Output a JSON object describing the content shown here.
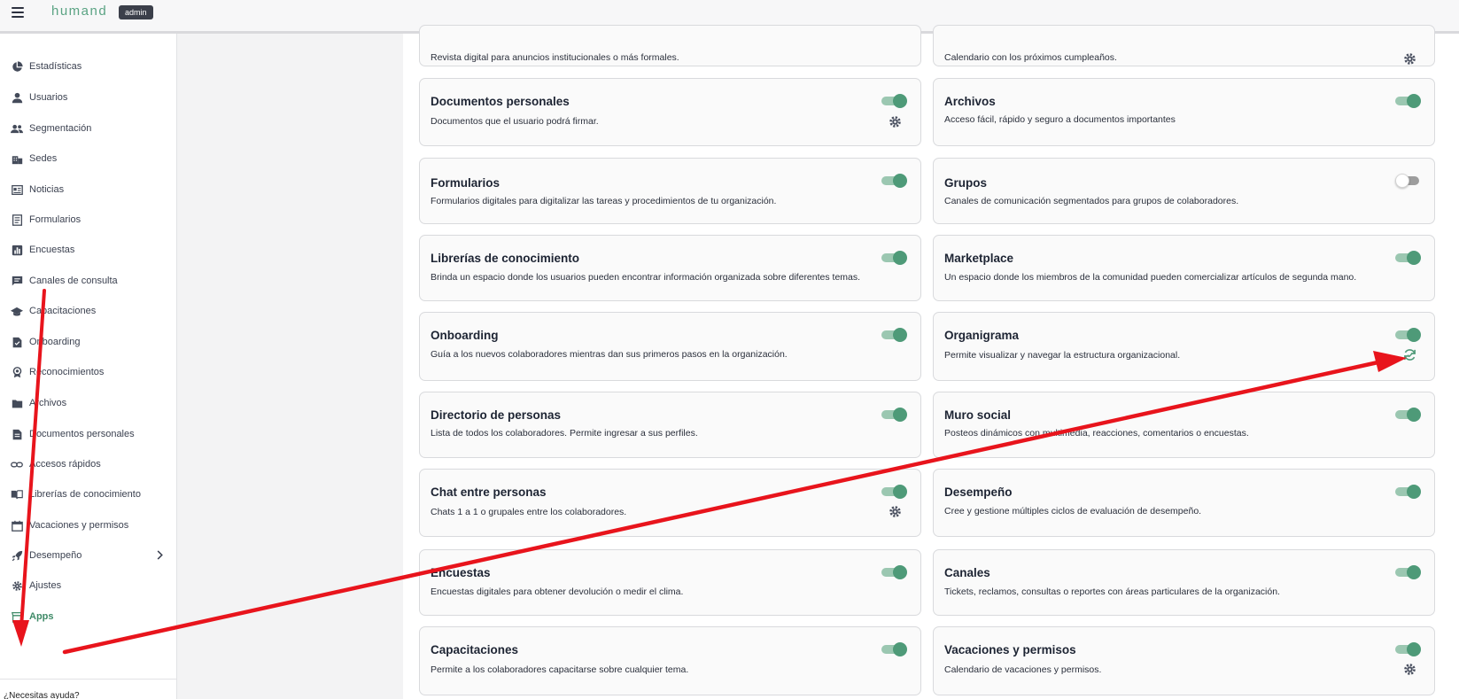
{
  "topbar": {
    "logo": "humand",
    "badge": "admin"
  },
  "sidebar": {
    "items": [
      {
        "label": "Estadísticas",
        "icon": "pie-chart-icon"
      },
      {
        "label": "Usuarios",
        "icon": "user-icon"
      },
      {
        "label": "Segmentación",
        "icon": "users-group-icon"
      },
      {
        "label": "Sedes",
        "icon": "building-icon"
      },
      {
        "label": "Noticias",
        "icon": "newspaper-icon"
      },
      {
        "label": "Formularios",
        "icon": "form-list-icon"
      },
      {
        "label": "Encuestas",
        "icon": "bar-chart-icon"
      },
      {
        "label": "Canales de consulta",
        "icon": "chat-icon"
      },
      {
        "label": "Capacitaciones",
        "icon": "graduation-cap-icon"
      },
      {
        "label": "Onboarding",
        "icon": "document-check-icon"
      },
      {
        "label": "Reconocimientos",
        "icon": "award-icon"
      },
      {
        "label": "Archivos",
        "icon": "folder-icon"
      },
      {
        "label": "Documentos personales",
        "icon": "file-text-icon"
      },
      {
        "label": "Accesos rápidos",
        "icon": "link-icon"
      },
      {
        "label": "Librerías de conocimiento",
        "icon": "book-icon"
      },
      {
        "label": "Vacaciones y permisos",
        "icon": "calendar-icon"
      },
      {
        "label": "Desempeño",
        "icon": "rocket-icon"
      },
      {
        "label": "Ajustes",
        "icon": "gear-icon"
      },
      {
        "label": "Apps",
        "icon": "apps-store-icon"
      }
    ],
    "help": "¿Necesitas ayuda?"
  },
  "cards": [
    {
      "title": "",
      "desc": "Revista digital para anuncios institucionales o más formales."
    },
    {
      "title": "",
      "desc": "Calendario con los próximos cumpleaños."
    },
    {
      "title": "Documentos personales",
      "desc": "Documentos que el usuario podrá firmar."
    },
    {
      "title": "Archivos",
      "desc": "Acceso fácil, rápido y seguro a documentos importantes"
    },
    {
      "title": "Formularios",
      "desc": "Formularios digitales para digitalizar las tareas y procedimientos de tu organización."
    },
    {
      "title": "Grupos",
      "desc": "Canales de comunicación segmentados para grupos de colaboradores."
    },
    {
      "title": "Librerías de conocimiento",
      "desc": "Brinda un espacio donde los usuarios pueden encontrar información organizada sobre diferentes temas."
    },
    {
      "title": "Marketplace",
      "desc": "Un espacio donde los miembros de la comunidad pueden comercializar artículos de segunda mano."
    },
    {
      "title": "Onboarding",
      "desc": "Guía a los nuevos colaboradores mientras dan sus primeros pasos en la organización."
    },
    {
      "title": "Organigrama",
      "desc": "Permite visualizar y navegar la estructura organizacional."
    },
    {
      "title": "Directorio de personas",
      "desc": "Lista de todos los colaboradores. Permite ingresar a sus perfiles."
    },
    {
      "title": "Muro social",
      "desc": "Posteos dinámicos con multimedia, reacciones, comentarios o encuestas."
    },
    {
      "title": "Chat entre personas",
      "desc": "Chats 1 a 1 o grupales entre los colaboradores."
    },
    {
      "title": "Desempeño",
      "desc": "Cree y gestione múltiples ciclos de evaluación de desempeño."
    },
    {
      "title": "Encuestas",
      "desc": "Encuestas digitales para obtener devolución o medir el clima."
    },
    {
      "title": "Canales",
      "desc": "Tickets, reclamos, consultas o reportes con áreas particulares de la organización."
    },
    {
      "title": "Capacitaciones",
      "desc": "Permite a los colaboradores capacitarse sobre cualquier tema."
    },
    {
      "title": "Vacaciones y permisos",
      "desc": "Calendario de vacaciones y permisos."
    }
  ],
  "colors": {
    "accent": "#4e9a78",
    "arrow": "#e8141c"
  }
}
